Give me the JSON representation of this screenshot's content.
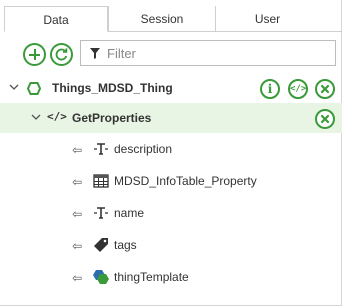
{
  "tabs": [
    "Data",
    "Session",
    "User"
  ],
  "toolbar": {
    "filter_placeholder": "Filter"
  },
  "tree": {
    "thing": {
      "label": "Things_MDSD_Thing"
    },
    "service": {
      "label": "GetProperties",
      "glyph": "</>"
    },
    "properties": [
      {
        "label": "description",
        "icon": "string-type-icon"
      },
      {
        "label": "MDSD_InfoTable_Property",
        "icon": "infotable-type-icon"
      },
      {
        "label": "name",
        "icon": "string-type-icon"
      },
      {
        "label": "tags",
        "icon": "tag-type-icon"
      },
      {
        "label": "thingTemplate",
        "icon": "thingtemplate-type-icon"
      }
    ],
    "arrow_glyph": "⇦"
  },
  "actions": {
    "info": "i",
    "code": "</>"
  },
  "colors": {
    "accent_green": "#3a9a3a",
    "selected_row": "#e9f5e4"
  }
}
